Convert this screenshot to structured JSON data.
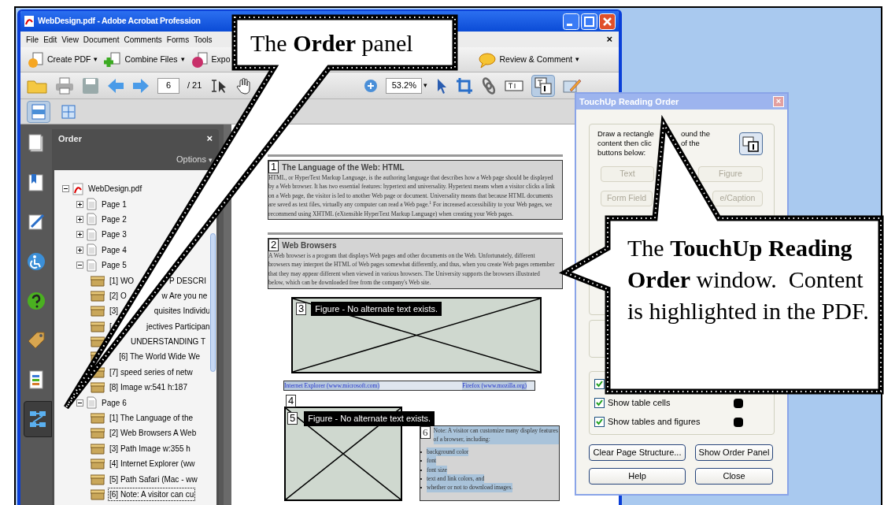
{
  "window": {
    "title": "WebDesign.pdf - Adobe Acrobat Profession"
  },
  "menu": [
    "File",
    "Edit",
    "View",
    "Document",
    "Comments",
    "Forms",
    "Tools"
  ],
  "menu_close": "×",
  "task_buttons": [
    {
      "kind": "create",
      "label": "Create PDF",
      "caret": "▾"
    },
    {
      "kind": "combine",
      "label": "Combine Files",
      "caret": "▾"
    },
    {
      "kind": "export",
      "label": "Expo"
    },
    {
      "kind": "review",
      "label": "Review & Comment",
      "caret": "▾"
    }
  ],
  "navigation": {
    "page": "6",
    "total": "/ 21",
    "zoom": "53.2%",
    "zoom_caret": "▾"
  },
  "reading_order_tool": {
    "selected": true
  },
  "view_buttons": [
    {
      "kind": "fit-width",
      "selected": true
    },
    {
      "kind": "fit-page",
      "selected": false
    }
  ],
  "sidebar_tabs": [
    {
      "kind": "pages",
      "selected": false
    },
    {
      "kind": "bookmarks",
      "selected": false
    },
    {
      "kind": "signatures",
      "selected": false
    },
    {
      "kind": "accessibility",
      "selected": false
    },
    {
      "kind": "help",
      "selected": false
    },
    {
      "kind": "tags",
      "selected": false
    },
    {
      "kind": "content",
      "selected": false
    },
    {
      "kind": "order",
      "selected": true
    }
  ],
  "order_panel": {
    "title": "Order",
    "close": "×",
    "options": "Options",
    "options_caret": "▾",
    "tree": [
      {
        "kind": "file",
        "label": "WebDesign.pdf",
        "expanded": true,
        "children": [
          {
            "kind": "page",
            "label": "Page 1",
            "expanded": false
          },
          {
            "kind": "page",
            "label": "Page 2",
            "expanded": false
          },
          {
            "kind": "page",
            "label": "Page 3",
            "expanded": false
          },
          {
            "kind": "page",
            "label": "Page 4",
            "expanded": false
          },
          {
            "kind": "page",
            "label": "Page 5",
            "expanded": true,
            "children": [
              {
                "kind": "item",
                "parts": [
                  "[1]  WO",
                  "P DESCRI"
                ],
                "selected": false
              },
              {
                "kind": "item",
                "parts": [
                  "[2]  O",
                  "w Are you ne"
                ],
                "selected": false
              },
              {
                "kind": "item",
                "parts": [
                  "[3]",
                  "quisites Individu"
                ],
                "selected": false
              },
              {
                "kind": "item",
                "parts": [
                  "[",
                  "jectives Participan"
                ],
                "selected": false
              },
              {
                "kind": "item",
                "label": "UNDERSTANDING T",
                "selected": false
              },
              {
                "kind": "item",
                "label": "[6]   The World Wide We",
                "selected": false
              },
              {
                "kind": "item",
                "label": "[7]  speed series of netw",
                "selected": false
              },
              {
                "kind": "item",
                "label": "[8]  Image   w:541 h:187",
                "selected": false
              }
            ]
          },
          {
            "kind": "page",
            "label": "Page 6",
            "expanded": true,
            "children": [
              {
                "kind": "item",
                "label": "[1]  The Language of the",
                "selected": false
              },
              {
                "kind": "item",
                "label": "[2]  Web Browsers A Web",
                "selected": false
              },
              {
                "kind": "item",
                "label": "[3]  Path Image   w:355 h",
                "selected": false
              },
              {
                "kind": "item",
                "label": "[4]  Internet Explorer (ww",
                "selected": false
              },
              {
                "kind": "item",
                "label": "[5]  Path Safari (Mac - ww",
                "selected": false
              },
              {
                "kind": "item",
                "label": "[6]  Note: A visitor can cu",
                "selected": true
              }
            ]
          }
        ]
      }
    ]
  },
  "document": {
    "blocks": [
      {
        "kind": "text",
        "number": "1",
        "heading": "The Language of the Web: HTML",
        "paragraph": "HTML, or HyperText Markup Language, is the authoring language that describes how a Web page should be displayed by a Web browser.  It has two essential features: hypertext and universality.  Hypertext means when a visitor clicks a link on a Web page, the visitor is led to another Web page or document.  Universality means that because HTML documents are saved as text files, virtually any computer can read a Web page.$^{1}$  For increased accessibility to your Web pages, we recommend using XHTML (eXtensible HyperText Markup Language) when creating your Web pages."
      },
      {
        "kind": "text",
        "number": "2",
        "heading": "Web Browsers",
        "paragraph": "A Web browser is a program that displays Web pages and other documents on the Web.  Unfortunately, different browsers may interpret the HTML of Web pages somewhat differently, and thus, when you create Web pages remember that they may appear different when viewed in various browsers.  The University supports the browsers illustrated below, which can be downloaded free from the company's Web site."
      },
      {
        "kind": "figure",
        "number": "3",
        "label": "Figure - No alternate text exists."
      },
      {
        "kind": "captions",
        "number": "4",
        "links": [
          "Internet Explorer (www.microsoft.com)",
          "Firefox (www.mozilla.org)"
        ]
      },
      {
        "kind": "figure_note",
        "number": "5",
        "label": "Figure - No alternate text exists.",
        "note_number": "6",
        "note": "Note: A visitor can customize many display features of a browser, including:",
        "bullets": [
          "background color",
          "font",
          "font size",
          "text and link colors, and",
          "whether or not to download images."
        ]
      }
    ]
  },
  "dialog": {
    "title": "TouchUp Reading Order",
    "close": "×",
    "instructions": [
      [
        "Draw a rectangle",
        "ound the"
      ],
      [
        "content then clic",
        "of the"
      ],
      [
        "buttons below:"
      ]
    ],
    "buttons": [
      {
        "label": "Text",
        "disabled": true
      },
      {
        "label": "Figure",
        "disabled": true
      },
      {
        "label": "Form Field",
        "disabled": true
      },
      {
        "label": "e/Caption",
        "disabled": true
      }
    ],
    "checkboxes": [
      {
        "checked": true
      },
      {
        "label": "Show table cells",
        "checked": true
      },
      {
        "label": "Show tables and figures",
        "checked": true
      }
    ],
    "actions": [
      "Clear Page Structure...",
      "Show Order Panel",
      "Help",
      "Close"
    ]
  },
  "callouts": [
    {
      "kind": "order",
      "text": "The **Order** panel"
    },
    {
      "kind": "touchup",
      "text": "The **TouchUp Reading Order** window.  Content is highlighted in the PDF."
    }
  ]
}
